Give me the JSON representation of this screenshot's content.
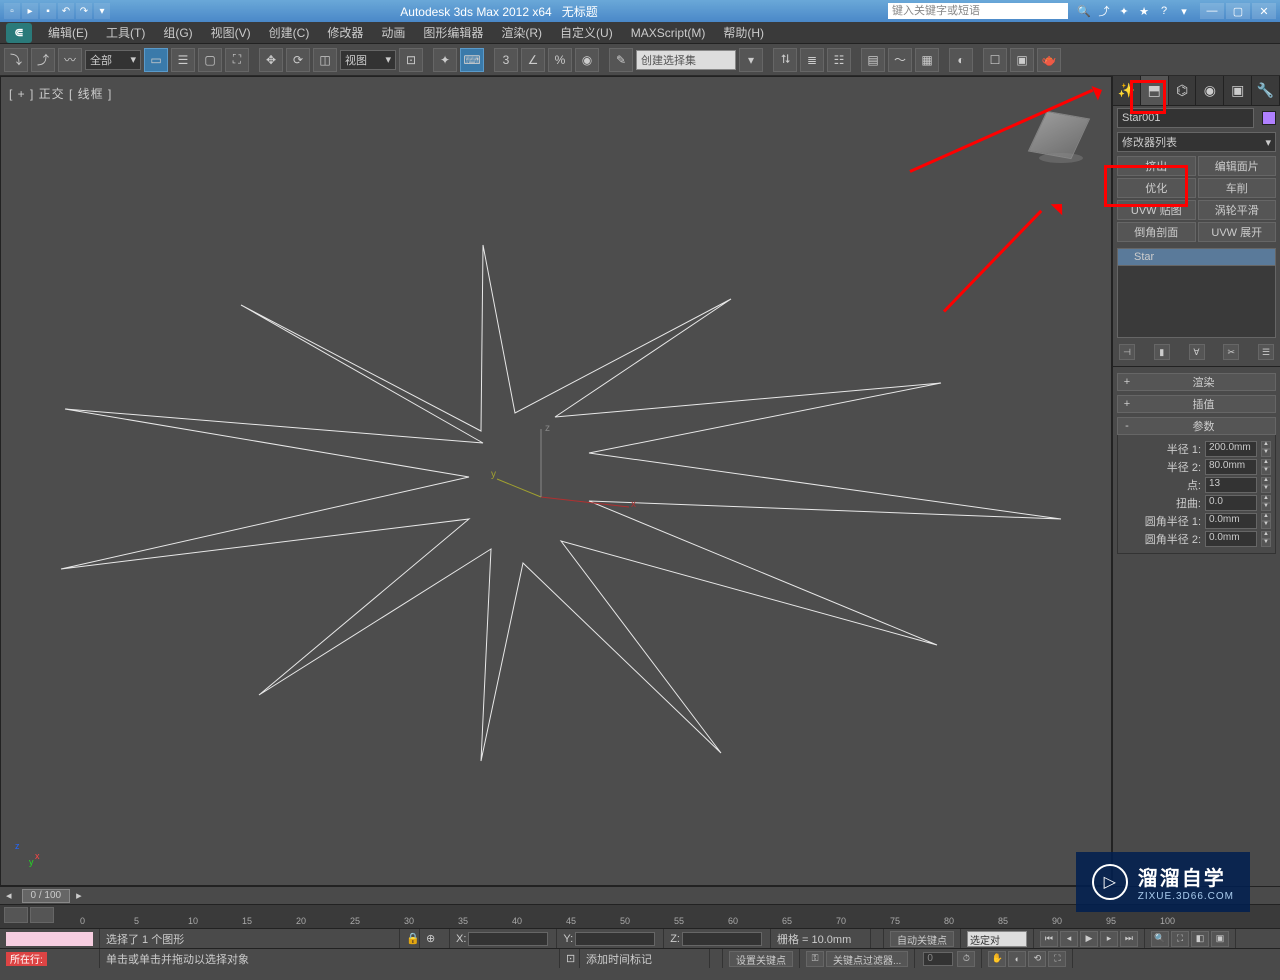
{
  "titlebar": {
    "app_title": "Autodesk 3ds Max 2012 x64",
    "doc_title": "无标题",
    "search_placeholder": "键入关键字或短语"
  },
  "menus": {
    "edit": "编辑(E)",
    "tools": "工具(T)",
    "group": "组(G)",
    "views": "视图(V)",
    "create": "创建(C)",
    "modifiers": "修改器",
    "animation": "动画",
    "graph": "图形编辑器",
    "rendering": "渲染(R)",
    "customize": "自定义(U)",
    "maxscript": "MAXScript(M)",
    "help": "帮助(H)"
  },
  "toolbar": {
    "filter_all": "全部",
    "view_dd": "视图",
    "sel_set": "创建选择集"
  },
  "viewport": {
    "label": "[ + ] 正交 [ 线框 ]"
  },
  "cmd": {
    "object_name": "Star001",
    "modifier_list": "修改器列表",
    "mod_buttons": {
      "extrude": "挤出",
      "edit_patch": "编辑面片",
      "optimize": "优化",
      "lathe": "车削",
      "uvw_map": "UVW 贴图",
      "turbosmooth": "涡轮平滑",
      "bevel_profile": "倒角剖面",
      "uvw_unwrap": "UVW 展开"
    },
    "stack_item": "Star",
    "rollouts": {
      "render": "渲染",
      "interpolation": "插值",
      "params": "参数"
    },
    "params": {
      "radius1_label": "半径 1:",
      "radius1_val": "200.0mm",
      "radius2_label": "半径 2:",
      "radius2_val": "80.0mm",
      "points_label": "点:",
      "points_val": "13",
      "distortion_label": "扭曲:",
      "distortion_val": "0.0",
      "fillet1_label": "圆角半径 1:",
      "fillet1_val": "0.0mm",
      "fillet2_label": "圆角半径 2:",
      "fillet2_val": "0.0mm"
    },
    "rollout_sign_plus": "+",
    "rollout_sign_minus": "-"
  },
  "timeline": {
    "slider": "0 / 100",
    "ticks": [
      "0",
      "5",
      "10",
      "15",
      "20",
      "25",
      "30",
      "35",
      "40",
      "45",
      "50",
      "55",
      "60",
      "65",
      "70",
      "75",
      "80",
      "85",
      "90",
      "95",
      "100"
    ]
  },
  "status": {
    "sel_info": "选择了 1 个图形",
    "prompt": "单击或单击并拖动以选择对象",
    "maxscript_label": "所在行:",
    "x": "X:",
    "y": "Y:",
    "z": "Z:",
    "grid": "栅格 = 10.0mm",
    "add_time_tag": "添加时间标记",
    "auto_key": "自动关键点",
    "set_key": "设置关键点",
    "sel_filter": "选定对",
    "key_filter": "关键点过滤器..."
  },
  "watermark": {
    "big": "溜溜自学",
    "small": "ZIXUE.3D66.COM"
  }
}
